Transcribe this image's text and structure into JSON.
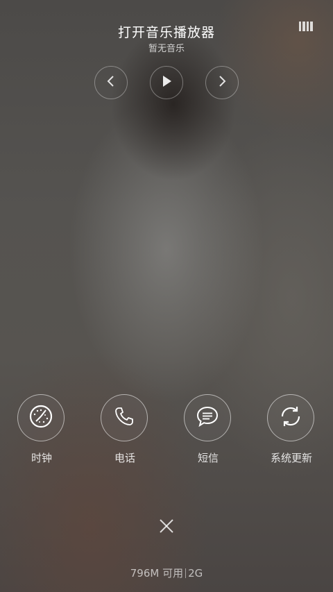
{
  "music": {
    "title": "打开音乐播放器",
    "subtitle": "暂无音乐"
  },
  "icons": {
    "top_right": "equalizer-icon",
    "prev": "chevron-left-icon",
    "play": "play-icon",
    "next": "chevron-right-icon",
    "close": "close-icon"
  },
  "shortcuts": [
    {
      "label": "时钟",
      "icon": "clock-icon"
    },
    {
      "label": "电话",
      "icon": "phone-icon"
    },
    {
      "label": "短信",
      "icon": "message-icon"
    },
    {
      "label": "系统更新",
      "icon": "sync-icon"
    }
  ],
  "footer": {
    "memory": "796M 可用",
    "network": "2G"
  }
}
